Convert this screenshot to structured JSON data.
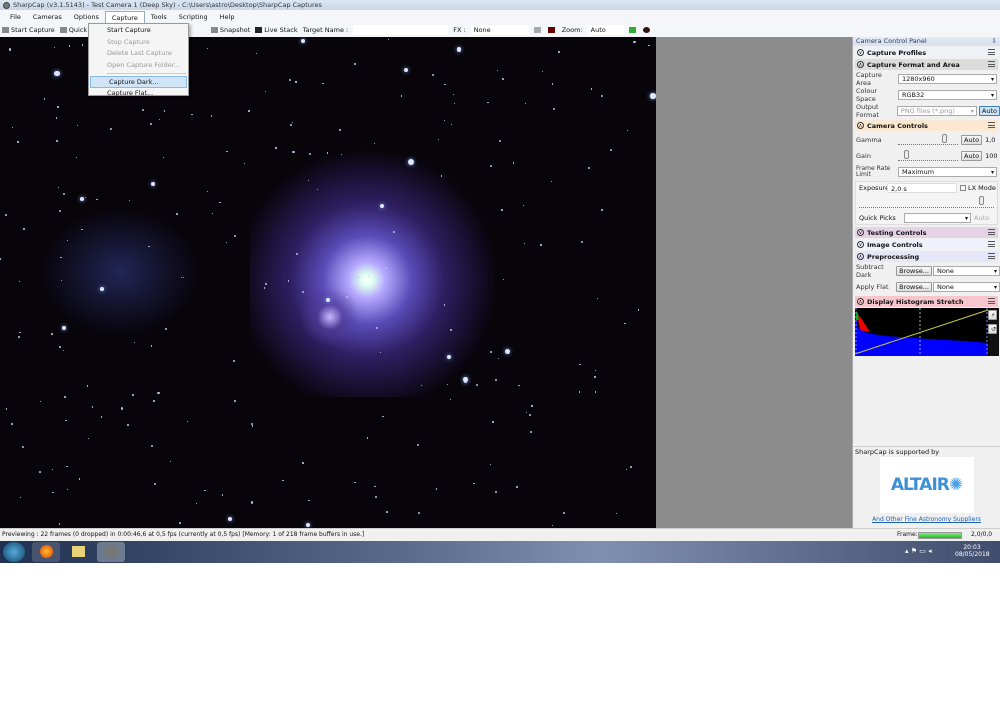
{
  "window": {
    "title": "SharpCap (v3.1.5143) - Test Camera 1 (Deep Sky) - C:\\Users\\astro\\Desktop\\SharpCap Captures"
  },
  "menubar": [
    "File",
    "Cameras",
    "Options",
    "Capture",
    "Tools",
    "Scripting",
    "Help"
  ],
  "capture_menu": {
    "items": [
      "Start Capture",
      "Stop Capture",
      "Delete Last Capture",
      "Open Capture Folder...",
      "Capture Dark...",
      "Capture Flat..."
    ],
    "highlighted": "Capture Dark..."
  },
  "toolbar": {
    "start_capture": "Start Capture",
    "quick_capture": "Quick Cap",
    "snapshot": "Snapshot",
    "live_stack": "Live Stack",
    "target_label": "Target Name :",
    "target_value": "",
    "fx_label": "FX :",
    "fx_value": "None",
    "zoom_label": "Zoom:",
    "zoom_value": "Auto"
  },
  "panel": {
    "title": "Camera Control Panel",
    "pin": "⇩",
    "sections": {
      "profiles": "Capture Profiles",
      "format": "Capture Format and Area",
      "camera": "Camera Controls",
      "testing": "Testing Controls",
      "image": "Image Controls",
      "preproc": "Preprocessing",
      "histo": "Display Histogram Stretch"
    },
    "capture_area": {
      "label": "Capture Area",
      "value": "1280x960"
    },
    "colour_space": {
      "label": "Colour Space",
      "value": "RGB32"
    },
    "output_format": {
      "label": "Output Format",
      "value": "PNG files (*.png)",
      "auto": "Auto"
    },
    "gamma": {
      "label": "Gamma",
      "auto": "Auto",
      "value": "1,0",
      "fraction": 0.8
    },
    "gain": {
      "label": "Gain",
      "auto": "Auto",
      "value": "100",
      "fraction": 0.1
    },
    "frame_rate": {
      "label": "Frame Rate Limit",
      "value": "Maximum"
    },
    "exposure": {
      "label": "Exposure",
      "value": "2,0 s",
      "lx": "LX Mode"
    },
    "quick_picks": {
      "label": "Quick Picks",
      "value": "",
      "auto": "Auto"
    },
    "subtract_dark": {
      "label": "Subtract Dark",
      "browse": "Browse...",
      "value": "None"
    },
    "apply_flat": {
      "label": "Apply Flat",
      "browse": "Browse...",
      "value": "None"
    },
    "sponsor": {
      "text": "SharpCap is supported by",
      "logo": "ALTAIR",
      "link": "And Other Fine Astronomy Suppliers"
    }
  },
  "status": {
    "text": "Previewing : 22 frames (0 dropped) in 0:00:46,6 at 0,5 fps  (currently at 0,5 fps) [Memory: 1 of 218 frame buffers in use.]",
    "frame_label": "Frame:",
    "frame_value": "2,0/0,0"
  },
  "taskbar": {
    "time": "20:03",
    "date": "08/05/2018"
  }
}
